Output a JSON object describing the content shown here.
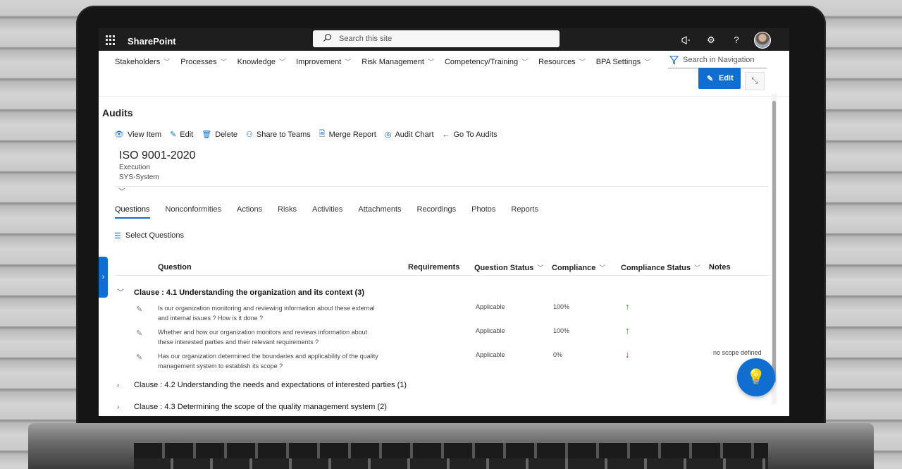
{
  "suite": {
    "app_name": "SharePoint",
    "search_placeholder": "Search this site"
  },
  "hubnav": {
    "items": [
      {
        "label": "Stakeholders"
      },
      {
        "label": "Processes"
      },
      {
        "label": "Knowledge"
      },
      {
        "label": "Improvement"
      },
      {
        "label": "Risk Management"
      },
      {
        "label": "Competency/Training"
      },
      {
        "label": "Resources"
      },
      {
        "label": "BPA Settings"
      }
    ],
    "search_label": "Search in Navigation"
  },
  "command": {
    "edit_label": "Edit"
  },
  "page": {
    "title": "Audits",
    "actions": [
      {
        "label": "View Item",
        "icon": "view-icon"
      },
      {
        "label": "Edit",
        "icon": "pencil-icon"
      },
      {
        "label": "Delete",
        "icon": "trash-icon"
      },
      {
        "label": "Share to Teams",
        "icon": "teams-icon"
      },
      {
        "label": "Merge Report",
        "icon": "document-icon"
      },
      {
        "label": "Audit Chart",
        "icon": "chart-icon"
      },
      {
        "label": "Go To Audits",
        "icon": "back-arrow-icon"
      }
    ]
  },
  "item": {
    "title": "ISO 9001-2020",
    "stage": "Execution",
    "system": "SYS-System"
  },
  "tabs": [
    {
      "label": "Questions",
      "active": true
    },
    {
      "label": "Nonconformities"
    },
    {
      "label": "Actions"
    },
    {
      "label": "Risks"
    },
    {
      "label": "Activities"
    },
    {
      "label": "Attachments"
    },
    {
      "label": "Recordings"
    },
    {
      "label": "Photos"
    },
    {
      "label": "Reports"
    }
  ],
  "select_questions_label": "Select Questions",
  "table": {
    "headers": {
      "question": "Question",
      "requirements": "Requirements",
      "question_status": "Question Status",
      "compliance": "Compliance",
      "compliance_status": "Compliance Status",
      "notes": "Notes"
    },
    "groups": [
      {
        "label": "Clause : 4.1 Understanding the organization and its context (3)",
        "expanded": true,
        "rows": [
          {
            "question_line1": "Is our organization monitoring and reviewing information about these external",
            "question_line2": "and internal issues ? How is it done ?",
            "status": "Applicable",
            "compliance": "100%",
            "compliance_status": "↑",
            "status_color": "#2e8b2e",
            "notes": ""
          },
          {
            "question_line1": "Whether and how our organization monitors and reviews information about",
            "question_line2": "these interested parties and their relevant requirements ?",
            "status": "Applicable",
            "compliance": "100%",
            "compliance_status": "↑",
            "status_color": "#2e8b2e",
            "notes": ""
          },
          {
            "question_line1": "Has our organization determined the boundaries and applicability of the quality",
            "question_line2": "management system to establish its scope ?",
            "status": "Applicable",
            "compliance": "0%",
            "compliance_status": "↓",
            "status_color": "#d32f2f",
            "notes": "no scope defined"
          }
        ]
      },
      {
        "label": "Clause : 4.2 Understanding the needs and expectations of interested parties (1)",
        "expanded": false
      },
      {
        "label": "Clause : 4.3 Determining the scope of the quality management system (2)",
        "expanded": false
      }
    ]
  },
  "colors": {
    "accent": "#0f6ecf",
    "suitebar": "#1e1e1e",
    "up_arrow": "#2e8b2e",
    "down_arrow": "#d32f2f"
  }
}
